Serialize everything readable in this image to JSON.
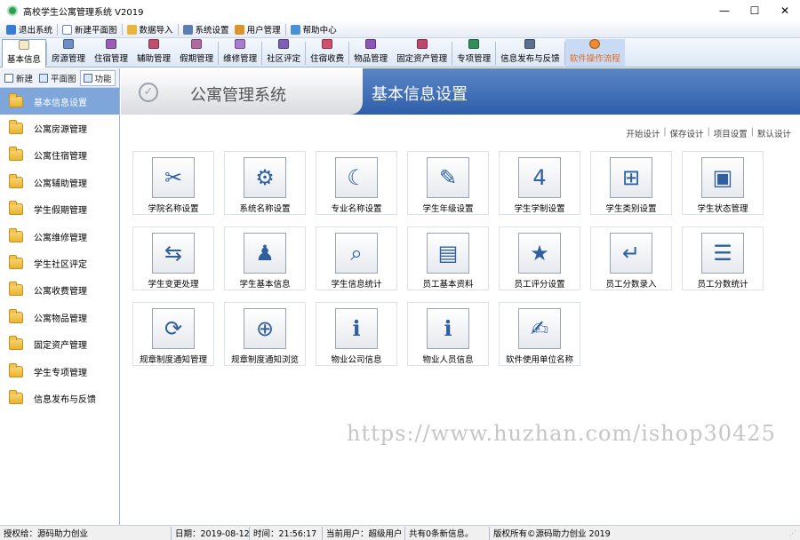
{
  "window": {
    "title": "高校学生公寓管理系统 V2019",
    "minimize": "—",
    "maximize": "☐",
    "close": "✕"
  },
  "menu": [
    "退出系统",
    "新建平面图",
    "数据导入",
    "系统设置",
    "用户管理",
    "帮助中心"
  ],
  "toolbar": [
    "基本信息",
    "房源管理",
    "住宿管理",
    "辅助管理",
    "假期管理",
    "维修管理",
    "社区评定",
    "住宿收费",
    "物品管理",
    "固定资产管理",
    "专项管理",
    "信息发布与反馈",
    "软件操作流程"
  ],
  "left_tabs": [
    "新建",
    "平面图",
    "功能"
  ],
  "nav": [
    "基本信息设置",
    "公寓房源管理",
    "公寓住宿管理",
    "公寓辅助管理",
    "学生假期管理",
    "公寓维修管理",
    "学生社区评定",
    "公寓收费管理",
    "公寓物品管理",
    "固定资产管理",
    "学生专项管理",
    "信息发布与反馈"
  ],
  "banner": {
    "title": "公寓管理系统",
    "subtitle": "基本信息设置"
  },
  "actions": [
    "开始设计",
    "保存设计",
    "项目设置",
    "默认设计"
  ],
  "cards": [
    {
      "label": "学院名称设置",
      "icon": "tools-icon",
      "glyph": "✂"
    },
    {
      "label": "系统名称设置",
      "icon": "gear-icon",
      "glyph": "⚙"
    },
    {
      "label": "专业名称设置",
      "icon": "moon-icon",
      "glyph": "☾"
    },
    {
      "label": "学生年级设置",
      "icon": "user-edit-icon",
      "glyph": "✎"
    },
    {
      "label": "学生学制设置",
      "icon": "calendar-icon",
      "glyph": "4"
    },
    {
      "label": "学生类别设置",
      "icon": "hierarchy-icon",
      "glyph": "⊞"
    },
    {
      "label": "学生状态管理",
      "icon": "monitor-icon",
      "glyph": "▣"
    },
    {
      "label": "学生变更处理",
      "icon": "transfer-icon",
      "glyph": "⇆"
    },
    {
      "label": "学生基本信息",
      "icon": "person-icon",
      "glyph": "♟"
    },
    {
      "label": "学生信息统计",
      "icon": "search-doc-icon",
      "glyph": "⌕"
    },
    {
      "label": "员工基本资料",
      "icon": "card-icon",
      "glyph": "▤"
    },
    {
      "label": "员工评分设置",
      "icon": "star-icon",
      "glyph": "★"
    },
    {
      "label": "员工分数录入",
      "icon": "enter-icon",
      "glyph": "↵"
    },
    {
      "label": "员工分数统计",
      "icon": "list-star-icon",
      "glyph": "☰"
    },
    {
      "label": "规章制度通知管理",
      "icon": "refresh-icon",
      "glyph": "⟳"
    },
    {
      "label": "规章制度通知浏览",
      "icon": "zoom-icon",
      "glyph": "⊕"
    },
    {
      "label": "物业公司信息",
      "icon": "info-icon",
      "glyph": "ℹ"
    },
    {
      "label": "物业人员信息",
      "icon": "info-list-icon",
      "glyph": "ℹ"
    },
    {
      "label": "软件使用单位名称",
      "icon": "pen-icon",
      "glyph": "✍"
    }
  ],
  "watermark": "https://www.huzhan.com/ishop30425",
  "status": [
    "授权给：源码助力创业",
    "日期：2019-08-12",
    "时间：21:56:17",
    "当前用户：超级用户",
    "共有0条新信息。",
    "版权所有©源码助力创业 2019"
  ]
}
